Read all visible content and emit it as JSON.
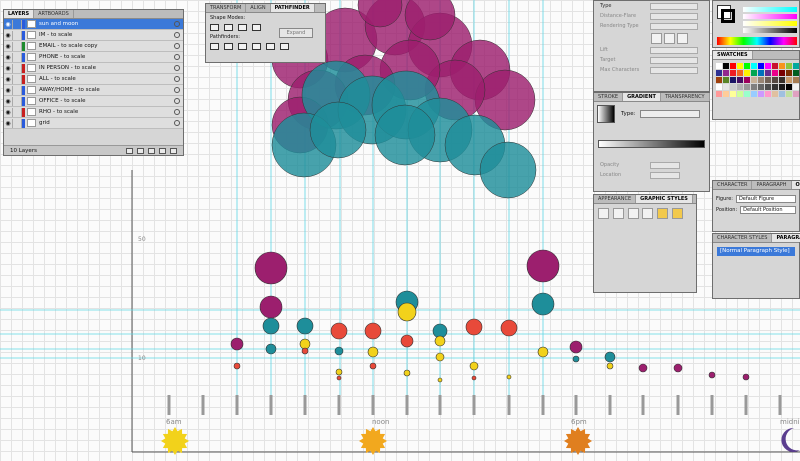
{
  "layers_panel": {
    "tabs": [
      "LAYERS",
      "ARTBOARDS"
    ],
    "layers": [
      {
        "name": "sun and moon",
        "color": "#2a5bdc",
        "selected": true
      },
      {
        "name": "IM - to scale",
        "color": "#2a5bdc",
        "selected": false
      },
      {
        "name": "EMAIL - to scale copy",
        "color": "#1e8c2e",
        "selected": false
      },
      {
        "name": "PHONE - to scale",
        "color": "#2a5bdc",
        "selected": false
      },
      {
        "name": "IN PERSON - to scale",
        "color": "#c82020",
        "selected": false
      },
      {
        "name": "ALL - to scale",
        "color": "#c82020",
        "selected": false
      },
      {
        "name": "AWAY/HOME - to scale",
        "color": "#2a5bdc",
        "selected": false
      },
      {
        "name": "OFFICE - to scale",
        "color": "#2a5bdc",
        "selected": false
      },
      {
        "name": "RHO - to scale",
        "color": "#c82020",
        "selected": false
      },
      {
        "name": "grid",
        "color": "#2a5bdc",
        "selected": false
      }
    ],
    "footer": "10 Layers"
  },
  "pathfinder_panel": {
    "tabs": [
      "TRANSFORM",
      "ALIGN",
      "PATHFINDER"
    ],
    "shape_modes_label": "Shape Modes:",
    "pathfinders_label": "Pathfinders:",
    "expand_label": "Expand"
  },
  "character_panel": {
    "top_label": "Type",
    "fields": [
      "Distance-Flare",
      "Rendering Type",
      "Lift",
      "Target",
      "Max Characters"
    ]
  },
  "swatches_panel": {
    "tab": "SWATCHES",
    "colors": [
      "#ffffff",
      "#000000",
      "#ff0000",
      "#ffff00",
      "#00ff00",
      "#00ffff",
      "#0000ff",
      "#ff00ff",
      "#c8102e",
      "#f7941d",
      "#8dc63f",
      "#00a99d",
      "#2e3192",
      "#92278f",
      "#ed1c24",
      "#f26522",
      "#fff200",
      "#00a651",
      "#0072bc",
      "#662d91",
      "#ec008c",
      "#790000",
      "#7b2e00",
      "#005e20",
      "#a0410d",
      "#598527",
      "#1b1464",
      "#440e62",
      "#9e005d",
      "#c7b299",
      "#998675",
      "#736357",
      "#534741",
      "#37302a",
      "#c69c6d",
      "#a67c52",
      "#ffffff",
      "#e6e6e6",
      "#cccccc",
      "#b3b3b3",
      "#999999",
      "#808080",
      "#666666",
      "#4d4d4d",
      "#333333",
      "#1a1a1a",
      "#000000",
      "#f2f2f2",
      "#ff9999",
      "#ffcc99",
      "#ffff99",
      "#ccff99",
      "#99ffcc",
      "#99ccff",
      "#cc99ff",
      "#ff99cc",
      "#e0c0a0",
      "#a0c0e0",
      "#c0e0a0",
      "#e0a0c0"
    ]
  },
  "gradient_panel": {
    "tabs": [
      "STROKE",
      "GRADIENT",
      "TRANSPARENCY"
    ],
    "type_label": "Type:",
    "opacity_label": "Opacity",
    "location_label": "Location"
  },
  "appearance_panel": {
    "tabs": [
      "APPEARANCE",
      "GRAPHIC STYLES"
    ]
  },
  "char_style_panel": {
    "tabs": [
      "CHARACTER",
      "PARAGRAPH",
      "OPENTYPE"
    ],
    "figure_label": "Figure:",
    "figure_value": "Default Figure",
    "position_label": "Position:",
    "position_value": "Default Position"
  },
  "para_style_panel": {
    "tabs": [
      "CHARACTER STYLES",
      "PARAGRAPH STYLES"
    ],
    "style_item": "[Normal Paragraph Style]"
  },
  "canvas": {
    "time_labels": [
      "6am",
      "noon",
      "6pm",
      "midni"
    ],
    "y_labels": [
      "50",
      "10"
    ],
    "colors": {
      "magenta": "#9c1f6e",
      "teal": "#1e8e9a",
      "red": "#e84a3a",
      "yellow": "#f2d21b",
      "guide": "#5fd7e5",
      "sun": "#f2d21b",
      "sun_noon": "#f2a81e",
      "sun_6pm": "#e07f1f",
      "moon": "#5b3e8f"
    }
  }
}
